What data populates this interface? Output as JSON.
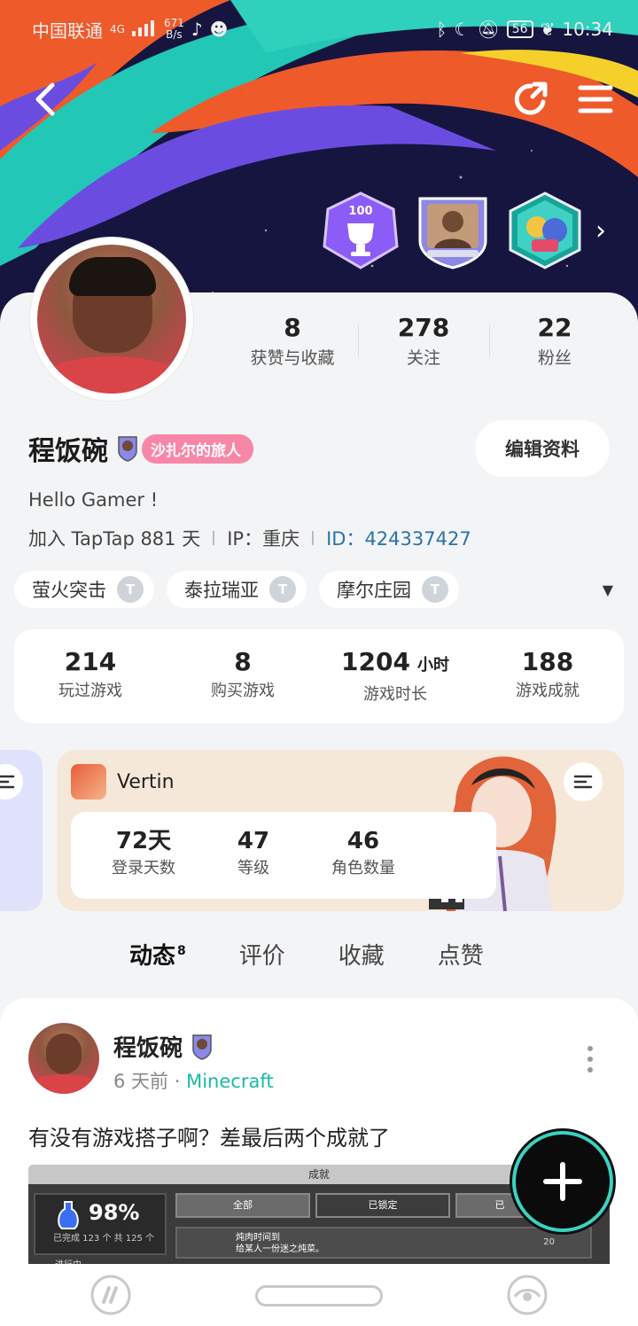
{
  "status_bar": {
    "carrier": "中国联通",
    "network": "4G",
    "speed_value": "671",
    "speed_unit": "B/s",
    "battery": "56",
    "time": "10:34"
  },
  "badges": [
    {
      "name": "trophy-100-badge",
      "text": "100"
    },
    {
      "name": "portrait-shield-badge"
    },
    {
      "name": "character-hex-badge"
    }
  ],
  "profile": {
    "name": "程饭碗",
    "title_tag": "沙扎尔的旅人",
    "bio": "Hello Gamer !",
    "joined": "加入 TapTap 881 天",
    "ip": "IP：重庆",
    "id": "ID：424337427",
    "edit_label": "编辑资料"
  },
  "top_stats": [
    {
      "value": "8",
      "label": "获赞与收藏"
    },
    {
      "value": "278",
      "label": "关注"
    },
    {
      "value": "22",
      "label": "粉丝"
    }
  ],
  "game_tags": [
    {
      "name": "萤火突击",
      "level": "T"
    },
    {
      "name": "泰拉瑞亚",
      "level": "T"
    },
    {
      "name": "摩尔庄园",
      "level": "T"
    }
  ],
  "game_stats": [
    {
      "value": "214",
      "unit": "",
      "label": "玩过游戏"
    },
    {
      "value": "8",
      "unit": "",
      "label": "购买游戏"
    },
    {
      "value": "1204",
      "unit": "小时",
      "label": "游戏时长"
    },
    {
      "value": "188",
      "unit": "",
      "label": "游戏成就"
    }
  ],
  "game_card": {
    "name": "Vertin",
    "stats": [
      {
        "value": "72天",
        "label": "登录天数"
      },
      {
        "value": "47",
        "label": "等级"
      },
      {
        "value": "46",
        "label": "角色数量"
      }
    ]
  },
  "tabs": [
    {
      "label": "动态",
      "count": "8",
      "active": true
    },
    {
      "label": "评价"
    },
    {
      "label": "收藏"
    },
    {
      "label": "点赞"
    }
  ],
  "post": {
    "author": "程饭碗",
    "time": "6 天前",
    "game": "Minecraft",
    "text": "有没有游戏搭子啊？差最后两个成就了",
    "image": {
      "title": "成就",
      "percent": "98%",
      "done": "已完成 123 个 共 125 个",
      "in_progress": "进行中",
      "seg_all": "全部",
      "seg_locked": "已锁定",
      "seg_third": "已",
      "row_title": "炖肉时间到",
      "row_desc": "给某人一份迷之炖菜。",
      "row_count": "20"
    }
  },
  "colors": {
    "accent": "#1ec8b0",
    "id_link": "#2a73a8",
    "title_tag": "#f887a7",
    "banner_bg": "#16153f"
  }
}
